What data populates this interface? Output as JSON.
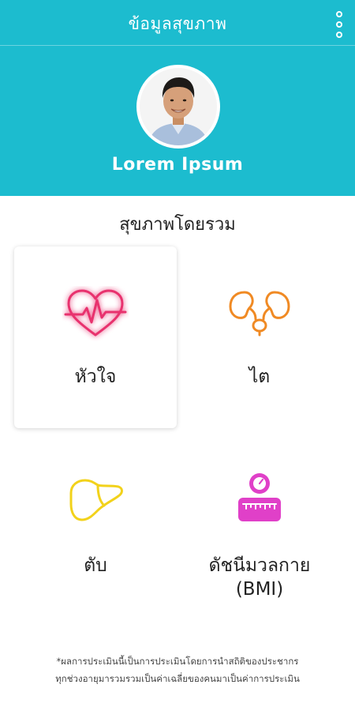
{
  "app": {
    "title": "ข้อมูลสุขภาพ",
    "menu_icon": "more-vertical-icon"
  },
  "profile": {
    "name": "Lorem Ipsum"
  },
  "overview": {
    "title": "สุขภาพโดยรวม",
    "items": [
      {
        "label": "หัวใจ",
        "icon": "heart-icon",
        "color": "#e8326e",
        "selected": true
      },
      {
        "label": "ไต",
        "icon": "kidney-icon",
        "color": "#f08a24"
      },
      {
        "label": "ตับ",
        "icon": "liver-icon",
        "color": "#f2d21b"
      },
      {
        "label": "ดัชนีมวลกาย\n(BMI)",
        "icon": "weight-scale-icon",
        "color": "#e040c8"
      }
    ]
  },
  "footnote": {
    "line1": "*ผลการประเมินนี้เป็นการประเมินโดยการนำสถิติของประชากร",
    "line2": "ทุกช่วงอายุมารวมรวมเป็นค่าเฉลี่ยของคนมาเป็นค่าการประเมิน"
  },
  "colors": {
    "header_bg": "#1cbccf",
    "heart": "#e8326e",
    "kidney": "#f08a24",
    "liver": "#f2d21b",
    "bmi": "#e040c8"
  }
}
